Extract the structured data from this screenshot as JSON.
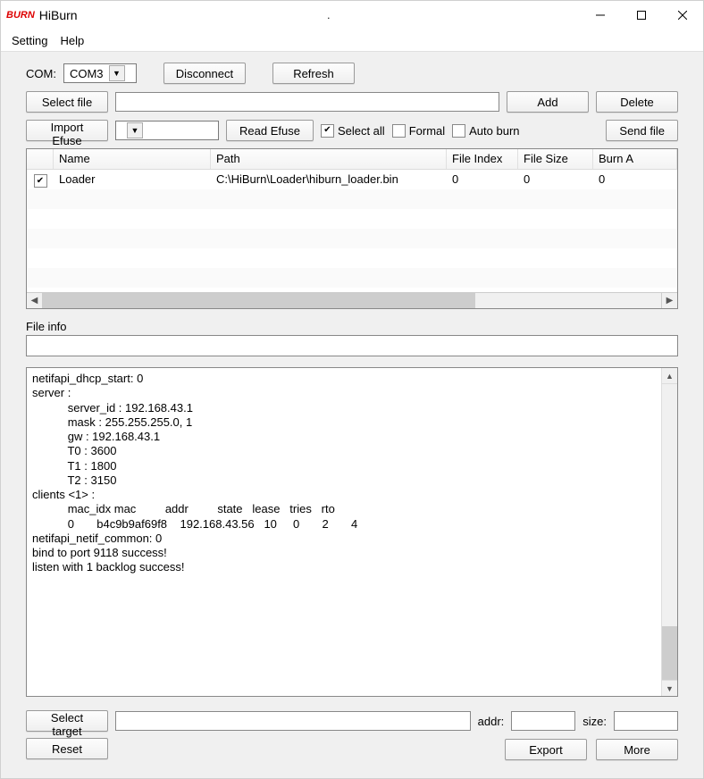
{
  "window": {
    "logo_text": "BURN",
    "title": "HiBurn",
    "center_dot": "."
  },
  "menu": {
    "setting": "Setting",
    "help": "Help"
  },
  "labels": {
    "com": "COM:",
    "file_info": "File info",
    "addr": "addr:",
    "size": "size:"
  },
  "com": {
    "selected": "COM3"
  },
  "buttons": {
    "disconnect": "Disconnect",
    "refresh": "Refresh",
    "select_file": "Select file",
    "add": "Add",
    "delete": "Delete",
    "import_efuse": "Import Efuse",
    "read_efuse": "Read Efuse",
    "send_file": "Send file",
    "select_target": "Select target",
    "reset": "Reset",
    "export": "Export",
    "more": "More"
  },
  "checkboxes": {
    "select_all": {
      "label": "Select all",
      "checked": true
    },
    "formal": {
      "label": "Formal",
      "checked": false
    },
    "auto_burn": {
      "label": "Auto burn",
      "checked": false
    }
  },
  "fields": {
    "file_path": "",
    "efuse_combo": "",
    "target": "",
    "addr": "",
    "size": ""
  },
  "table": {
    "headers": {
      "name": "Name",
      "path": "Path",
      "file_index": "File Index",
      "file_size": "File Size",
      "burn_addr": "Burn A"
    },
    "rows": [
      {
        "checked": true,
        "name": "Loader",
        "path": "C:\\HiBurn\\Loader\\hiburn_loader.bin",
        "file_index": "0",
        "file_size": "0",
        "burn_addr": "0"
      }
    ]
  },
  "log_text": "netifapi_dhcp_start: 0\nserver :\n           server_id : 192.168.43.1\n           mask : 255.255.255.0, 1\n           gw : 192.168.43.1\n           T0 : 3600\n           T1 : 1800\n           T2 : 3150\nclients <1> :\n           mac_idx mac         addr         state   lease   tries   rto\n           0       b4c9b9af69f8    192.168.43.56   10     0       2       4\nnetifapi_netif_common: 0\nbind to port 9118 success!\nlisten with 1 backlog success!"
}
